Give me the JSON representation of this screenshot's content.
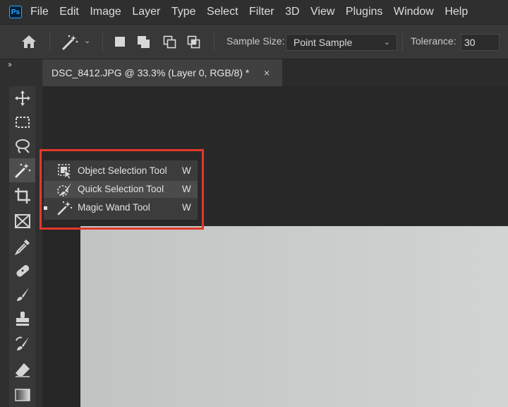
{
  "app": {
    "logo_text": "Ps"
  },
  "menu": [
    "File",
    "Edit",
    "Image",
    "Layer",
    "Type",
    "Select",
    "Filter",
    "3D",
    "View",
    "Plugins",
    "Window",
    "Help"
  ],
  "options_bar": {
    "sample_size_label": "Sample Size:",
    "sample_size_value": "Point Sample",
    "tolerance_label": "Tolerance:",
    "tolerance_value": "30"
  },
  "panel_toggle": "››",
  "document_tab": {
    "title": "DSC_8412.JPG @ 33.3% (Layer 0, RGB/8) *",
    "close": "×"
  },
  "toolbar": {
    "tools": [
      "move-tool",
      "marquee-tool",
      "lasso-tool",
      "magic-wand-tool",
      "crop-tool",
      "frame-tool",
      "eyedropper-tool",
      "healing-brush-tool",
      "brush-tool",
      "clone-stamp-tool",
      "history-brush-tool",
      "eraser-tool",
      "gradient-tool"
    ],
    "active": "magic-wand-tool"
  },
  "flyout": {
    "items": [
      {
        "label": "Object Selection Tool",
        "shortcut": "W",
        "icon": "object-selection-icon",
        "selected": false
      },
      {
        "label": "Quick Selection Tool",
        "shortcut": "W",
        "icon": "quick-selection-icon",
        "selected": false
      },
      {
        "label": "Magic Wand Tool",
        "shortcut": "W",
        "icon": "magic-wand-icon",
        "selected": true
      }
    ]
  },
  "colors": {
    "highlight": "#e2392b",
    "chrome": "#2f2f2f",
    "options_bar": "#383838"
  }
}
